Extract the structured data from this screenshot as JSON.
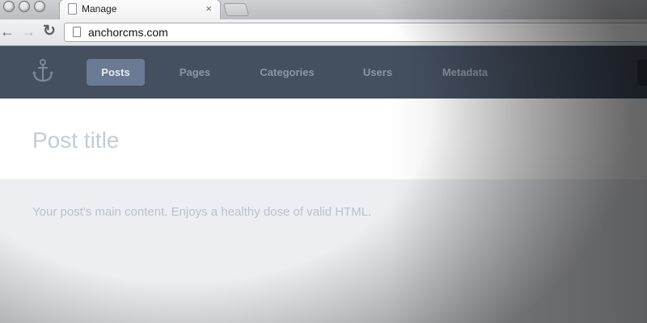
{
  "browser": {
    "tab_title": "Manage",
    "tab_close_glyph": "×",
    "url": "anchorcms.com",
    "back_glyph": "←",
    "forward_glyph": "→",
    "reload_glyph": "↻"
  },
  "nav": {
    "logo_icon": "anchor-icon",
    "items": [
      {
        "label": "Posts",
        "active": true
      },
      {
        "label": "Pages",
        "active": false
      },
      {
        "label": "Categories",
        "active": false
      },
      {
        "label": "Users",
        "active": false
      },
      {
        "label": "Metadata",
        "active": false
      }
    ]
  },
  "editor": {
    "title_placeholder": "Post title",
    "content_placeholder": "Your post's main content. Enjoys a healthy dose of valid HTML."
  },
  "colors": {
    "nav_bg": "#444f5f",
    "nav_active": "#6b7a93",
    "placeholder": "#c5cbd6"
  }
}
